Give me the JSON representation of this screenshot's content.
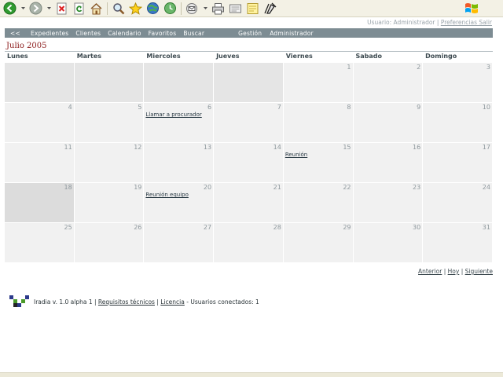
{
  "browser": {
    "icons": [
      "back-icon",
      "forward-icon",
      "stop-icon",
      "refresh-icon",
      "home-icon",
      "search-icon",
      "favorites-icon",
      "media-icon",
      "history-icon",
      "mail-icon",
      "print-icon",
      "edit-icon",
      "discuss-icon",
      "messenger-icon"
    ],
    "accent": "#2a8a2a"
  },
  "user_bar": {
    "user_text": "Usuario: Administrador",
    "separator": "|",
    "prefs_label": "Preferencias Salir"
  },
  "nav": {
    "back_label": "<<",
    "items": [
      "Expedientes",
      "Clientes",
      "Calendario",
      "Favoritos",
      "Buscar"
    ],
    "right_items": [
      "Gestión",
      "Administrador"
    ],
    "color": "#7d8c93"
  },
  "calendar": {
    "title": "Julio 2005",
    "weekdays": [
      "Lunes",
      "Martes",
      "Miercoles",
      "Jueves",
      "Viernes",
      "Sabado",
      "Domingo"
    ],
    "cells": [
      {
        "day": "",
        "event": "",
        "style": "empty"
      },
      {
        "day": "",
        "event": "",
        "style": "empty"
      },
      {
        "day": "",
        "event": "",
        "style": "empty"
      },
      {
        "day": "",
        "event": "",
        "style": "empty"
      },
      {
        "day": "1",
        "event": "",
        "style": ""
      },
      {
        "day": "2",
        "event": "",
        "style": ""
      },
      {
        "day": "3",
        "event": "",
        "style": ""
      },
      {
        "day": "4",
        "event": "",
        "style": ""
      },
      {
        "day": "5",
        "event": "",
        "style": ""
      },
      {
        "day": "6",
        "event": "Llamar a procurador",
        "style": ""
      },
      {
        "day": "7",
        "event": "",
        "style": ""
      },
      {
        "day": "8",
        "event": "",
        "style": ""
      },
      {
        "day": "9",
        "event": "",
        "style": ""
      },
      {
        "day": "10",
        "event": "",
        "style": ""
      },
      {
        "day": "11",
        "event": "",
        "style": ""
      },
      {
        "day": "12",
        "event": "",
        "style": ""
      },
      {
        "day": "13",
        "event": "",
        "style": ""
      },
      {
        "day": "14",
        "event": "",
        "style": ""
      },
      {
        "day": "15",
        "event": "Reunión",
        "style": ""
      },
      {
        "day": "16",
        "event": "",
        "style": ""
      },
      {
        "day": "17",
        "event": "",
        "style": ""
      },
      {
        "day": "18",
        "event": "",
        "style": "today"
      },
      {
        "day": "19",
        "event": "",
        "style": ""
      },
      {
        "day": "20",
        "event": "Reunión equipo",
        "style": ""
      },
      {
        "day": "21",
        "event": "",
        "style": ""
      },
      {
        "day": "22",
        "event": "",
        "style": ""
      },
      {
        "day": "23",
        "event": "",
        "style": ""
      },
      {
        "day": "24",
        "event": "",
        "style": ""
      },
      {
        "day": "25",
        "event": "",
        "style": ""
      },
      {
        "day": "26",
        "event": "",
        "style": ""
      },
      {
        "day": "27",
        "event": "",
        "style": ""
      },
      {
        "day": "28",
        "event": "",
        "style": ""
      },
      {
        "day": "29",
        "event": "",
        "style": ""
      },
      {
        "day": "30",
        "event": "",
        "style": ""
      },
      {
        "day": "31",
        "event": "",
        "style": ""
      }
    ]
  },
  "pager": {
    "prev": "Anterior",
    "today": "Hoy",
    "next": "Siguiente",
    "sep": "|"
  },
  "footer": {
    "version": "Iradia v. 1.0 alpha 1",
    "sep": "|",
    "requirements": "Requisitos técnicos",
    "license": "Licencia",
    "connected": "- Usuarios conectados: 1"
  }
}
